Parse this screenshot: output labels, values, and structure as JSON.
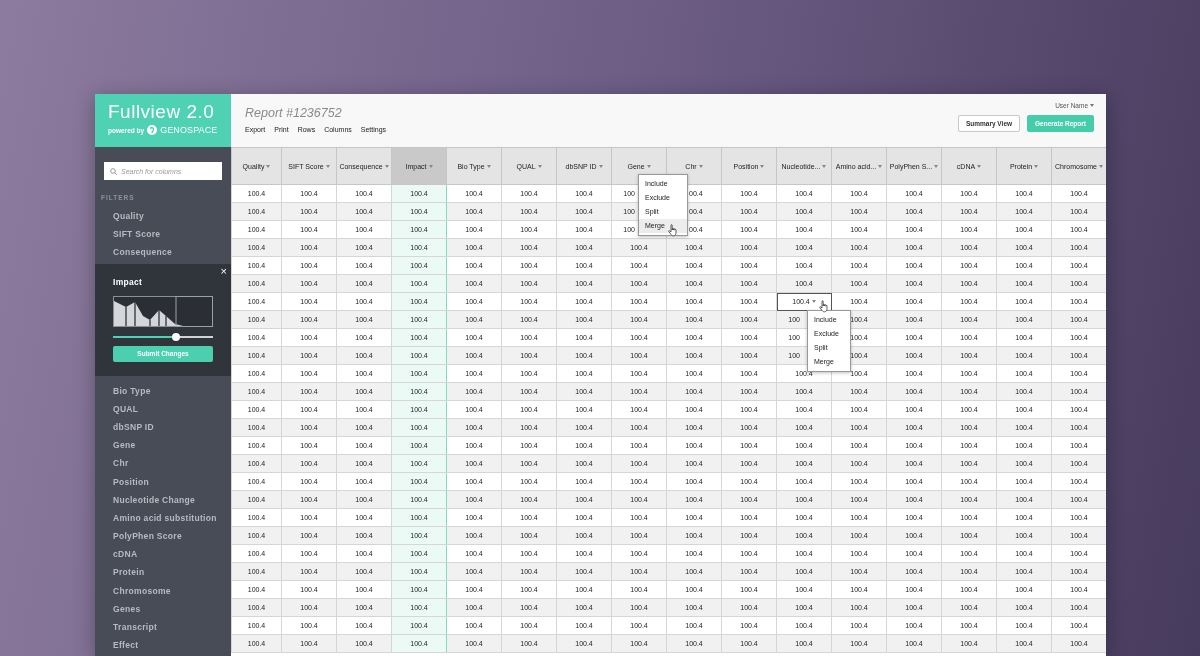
{
  "app": {
    "title": "Fullview 2.0",
    "powered_by": "powered by",
    "brand": "GENOSPACE"
  },
  "sidebar": {
    "search": {
      "placeholder": "Search for columns"
    },
    "section_label": "FILTERS",
    "filters": [
      {
        "label": "Quality",
        "expanded": false
      },
      {
        "label": "SIFT Score",
        "expanded": false
      },
      {
        "label": "Consequence",
        "expanded": false
      },
      {
        "label": "Impact",
        "expanded": true
      },
      {
        "label": "Bio Type",
        "expanded": false
      },
      {
        "label": "QUAL",
        "expanded": false
      },
      {
        "label": "dbSNP ID",
        "expanded": false
      },
      {
        "label": "Gene",
        "expanded": false
      },
      {
        "label": "Chr",
        "expanded": false
      },
      {
        "label": "Position",
        "expanded": false
      },
      {
        "label": "Nucleotide Change",
        "expanded": false
      },
      {
        "label": "Amino acid substitution",
        "expanded": false
      },
      {
        "label": "PolyPhen Score",
        "expanded": false
      },
      {
        "label": "cDNA",
        "expanded": false
      },
      {
        "label": "Protein",
        "expanded": false
      },
      {
        "label": "Chromosome",
        "expanded": false
      },
      {
        "label": "Genes",
        "expanded": false
      },
      {
        "label": "Transcript",
        "expanded": false
      },
      {
        "label": "Effect",
        "expanded": false
      }
    ],
    "filter_panel": {
      "close": "×",
      "level": 0.63,
      "button": "Submit Changes"
    }
  },
  "report": {
    "title": "Report #1236752",
    "menu": [
      "Export",
      "Print",
      "Rows",
      "Columns",
      "Settings"
    ],
    "user": "User Name",
    "buttons": [
      {
        "label": "Summary View",
        "kind": "secondary"
      },
      {
        "label": "Generate Report",
        "kind": "primary"
      }
    ]
  },
  "table": {
    "columns": [
      {
        "label": "Quality",
        "selected": false
      },
      {
        "label": "SIFT Score",
        "selected": false
      },
      {
        "label": "Consequence",
        "selected": false
      },
      {
        "label": "Impact",
        "selected": true
      },
      {
        "label": "Bio Type",
        "selected": false
      },
      {
        "label": "QUAL",
        "selected": false
      },
      {
        "label": "dbSNP ID",
        "selected": false
      },
      {
        "label": "Gene",
        "selected": false,
        "menu": [
          {
            "label": "Include",
            "hovered": false
          },
          {
            "label": "Exclude",
            "hovered": false
          },
          {
            "label": "Split",
            "hovered": false
          },
          {
            "label": "Merge",
            "hovered": true
          }
        ]
      },
      {
        "label": "Chr",
        "selected": false
      },
      {
        "label": "Position",
        "selected": false
      },
      {
        "label": "Nucleotide...",
        "selected": false
      },
      {
        "label": "Amino acid...",
        "selected": false
      },
      {
        "label": "PolyPhen S...",
        "selected": false
      },
      {
        "label": "cDNA",
        "selected": false
      },
      {
        "label": "Protein",
        "selected": false
      },
      {
        "label": "Chromosome",
        "selected": false
      }
    ],
    "rows": [
      [
        "100.4",
        "100.4",
        "100.4",
        "100.4",
        "100.4",
        "100.4",
        "100.4",
        {
          "value": "100",
          "cut_right": true,
          "cut_left": false
        },
        {
          "value": "00.4",
          "cut_right": false,
          "cut_left": true
        },
        "100.4",
        "100.4",
        "100.4",
        "100.4",
        "100.4",
        "100.4",
        "100.4"
      ],
      [
        "100.4",
        "100.4",
        "100.4",
        "100.4",
        "100.4",
        "100.4",
        "100.4",
        {
          "value": "100",
          "cut_right": true,
          "cut_left": false
        },
        {
          "value": "00.4",
          "cut_right": false,
          "cut_left": true
        },
        "100.4",
        "100.4",
        "100.4",
        "100.4",
        "100.4",
        "100.4",
        "100.4"
      ],
      [
        "100.4",
        "100.4",
        "100.4",
        "100.4",
        "100.4",
        "100.4",
        "100.4",
        {
          "value": "100",
          "cut_right": true,
          "cut_left": false
        },
        {
          "value": "00.4",
          "cut_right": false,
          "cut_left": true
        },
        "100.4",
        "100.4",
        "100.4",
        "100.4",
        "100.4",
        "100.4",
        "100.4"
      ],
      [
        "100.4",
        "100.4",
        "100.4",
        "100.4",
        "100.4",
        "100.4",
        "100.4",
        "100.4",
        "100.4",
        "100.4",
        "100.4",
        "100.4",
        "100.4",
        "100.4",
        "100.4",
        "100.4"
      ],
      [
        "100.4",
        "100.4",
        "100.4",
        "100.4",
        "100.4",
        "100.4",
        "100.4",
        "100.4",
        "100.4",
        "100.4",
        "100.4",
        "100.4",
        "100.4",
        "100.4",
        "100.4",
        "100.4"
      ],
      [
        "100.4",
        "100.4",
        "100.4",
        "100.4",
        "100.4",
        "100.4",
        "100.4",
        "100.4",
        "100.4",
        "100.4",
        "100.4",
        "100.4",
        "100.4",
        "100.4",
        "100.4",
        "100.4"
      ],
      [
        "100.4",
        "100.4",
        "100.4",
        "100.4",
        "100.4",
        "100.4",
        "100.4",
        "100.4",
        "100.4",
        "100.4",
        {
          "value": "100.4",
          "focused": true,
          "menu": [
            "Include",
            "Exclude",
            "Split",
            "Merge"
          ]
        },
        "100.4",
        "100.4",
        "100.4",
        "100.4",
        "100.4"
      ],
      [
        "100.4",
        "100.4",
        "100.4",
        "100.4",
        "100.4",
        "100.4",
        "100.4",
        "100.4",
        "100.4",
        "100.4",
        {
          "value": "100",
          "cut_right": true,
          "cut_left": false
        },
        "100.4",
        "100.4",
        "100.4",
        "100.4",
        "100.4"
      ],
      [
        "100.4",
        "100.4",
        "100.4",
        "100.4",
        "100.4",
        "100.4",
        "100.4",
        "100.4",
        "100.4",
        "100.4",
        {
          "value": "100",
          "cut_right": true,
          "cut_left": false
        },
        "100.4",
        "100.4",
        "100.4",
        "100.4",
        "100.4"
      ],
      [
        "100.4",
        "100.4",
        "100.4",
        "100.4",
        "100.4",
        "100.4",
        "100.4",
        "100.4",
        "100.4",
        "100.4",
        {
          "value": "100",
          "cut_right": true,
          "cut_left": false
        },
        "100.4",
        "100.4",
        "100.4",
        "100.4",
        "100.4"
      ],
      [
        "100.4",
        "100.4",
        "100.4",
        "100.4",
        "100.4",
        "100.4",
        "100.4",
        "100.4",
        "100.4",
        "100.4",
        "100.4",
        "100.4",
        "100.4",
        "100.4",
        "100.4",
        "100.4"
      ],
      [
        "100.4",
        "100.4",
        "100.4",
        "100.4",
        "100.4",
        "100.4",
        "100.4",
        "100.4",
        "100.4",
        "100.4",
        "100.4",
        "100.4",
        "100.4",
        "100.4",
        "100.4",
        "100.4"
      ],
      [
        "100.4",
        "100.4",
        "100.4",
        "100.4",
        "100.4",
        "100.4",
        "100.4",
        "100.4",
        "100.4",
        "100.4",
        "100.4",
        "100.4",
        "100.4",
        "100.4",
        "100.4",
        "100.4"
      ],
      [
        "100.4",
        "100.4",
        "100.4",
        "100.4",
        "100.4",
        "100.4",
        "100.4",
        "100.4",
        "100.4",
        "100.4",
        "100.4",
        "100.4",
        "100.4",
        "100.4",
        "100.4",
        "100.4"
      ],
      [
        "100.4",
        "100.4",
        "100.4",
        "100.4",
        "100.4",
        "100.4",
        "100.4",
        "100.4",
        "100.4",
        "100.4",
        "100.4",
        "100.4",
        "100.4",
        "100.4",
        "100.4",
        "100.4"
      ],
      [
        "100.4",
        "100.4",
        "100.4",
        "100.4",
        "100.4",
        "100.4",
        "100.4",
        "100.4",
        "100.4",
        "100.4",
        "100.4",
        "100.4",
        "100.4",
        "100.4",
        "100.4",
        "100.4"
      ],
      [
        "100.4",
        "100.4",
        "100.4",
        "100.4",
        "100.4",
        "100.4",
        "100.4",
        "100.4",
        "100.4",
        "100.4",
        "100.4",
        "100.4",
        "100.4",
        "100.4",
        "100.4",
        "100.4"
      ],
      [
        "100.4",
        "100.4",
        "100.4",
        "100.4",
        "100.4",
        "100.4",
        "100.4",
        "100.4",
        "100.4",
        "100.4",
        "100.4",
        "100.4",
        "100.4",
        "100.4",
        "100.4",
        "100.4"
      ],
      [
        "100.4",
        "100.4",
        "100.4",
        "100.4",
        "100.4",
        "100.4",
        "100.4",
        "100.4",
        "100.4",
        "100.4",
        "100.4",
        "100.4",
        "100.4",
        "100.4",
        "100.4",
        "100.4"
      ],
      [
        "100.4",
        "100.4",
        "100.4",
        "100.4",
        "100.4",
        "100.4",
        "100.4",
        "100.4",
        "100.4",
        "100.4",
        "100.4",
        "100.4",
        "100.4",
        "100.4",
        "100.4",
        "100.4"
      ],
      [
        "100.4",
        "100.4",
        "100.4",
        "100.4",
        "100.4",
        "100.4",
        "100.4",
        "100.4",
        "100.4",
        "100.4",
        "100.4",
        "100.4",
        "100.4",
        "100.4",
        "100.4",
        "100.4"
      ],
      [
        "100.4",
        "100.4",
        "100.4",
        "100.4",
        "100.4",
        "100.4",
        "100.4",
        "100.4",
        "100.4",
        "100.4",
        "100.4",
        "100.4",
        "100.4",
        "100.4",
        "100.4",
        "100.4"
      ],
      [
        "100.4",
        "100.4",
        "100.4",
        "100.4",
        "100.4",
        "100.4",
        "100.4",
        "100.4",
        "100.4",
        "100.4",
        "100.4",
        "100.4",
        "100.4",
        "100.4",
        "100.4",
        "100.4"
      ],
      [
        "100.4",
        "100.4",
        "100.4",
        "100.4",
        "100.4",
        "100.4",
        "100.4",
        "100.4",
        "100.4",
        "100.4",
        "100.4",
        "100.4",
        "100.4",
        "100.4",
        "100.4",
        "100.4"
      ],
      [
        "100.4",
        "100.4",
        "100.4",
        "100.4",
        "100.4",
        "100.4",
        "100.4",
        "100.4",
        "100.4",
        "100.4",
        "100.4",
        "100.4",
        "100.4",
        "100.4",
        "100.4",
        "100.4"
      ],
      [
        "100.4",
        "100.4",
        "100.4",
        "100.4",
        "100.4",
        "100.4",
        "100.4",
        "100.4",
        "100.4",
        "100.4",
        "100.4",
        "100.4",
        "100.4",
        "100.4",
        "100.4",
        "100.4"
      ]
    ]
  }
}
